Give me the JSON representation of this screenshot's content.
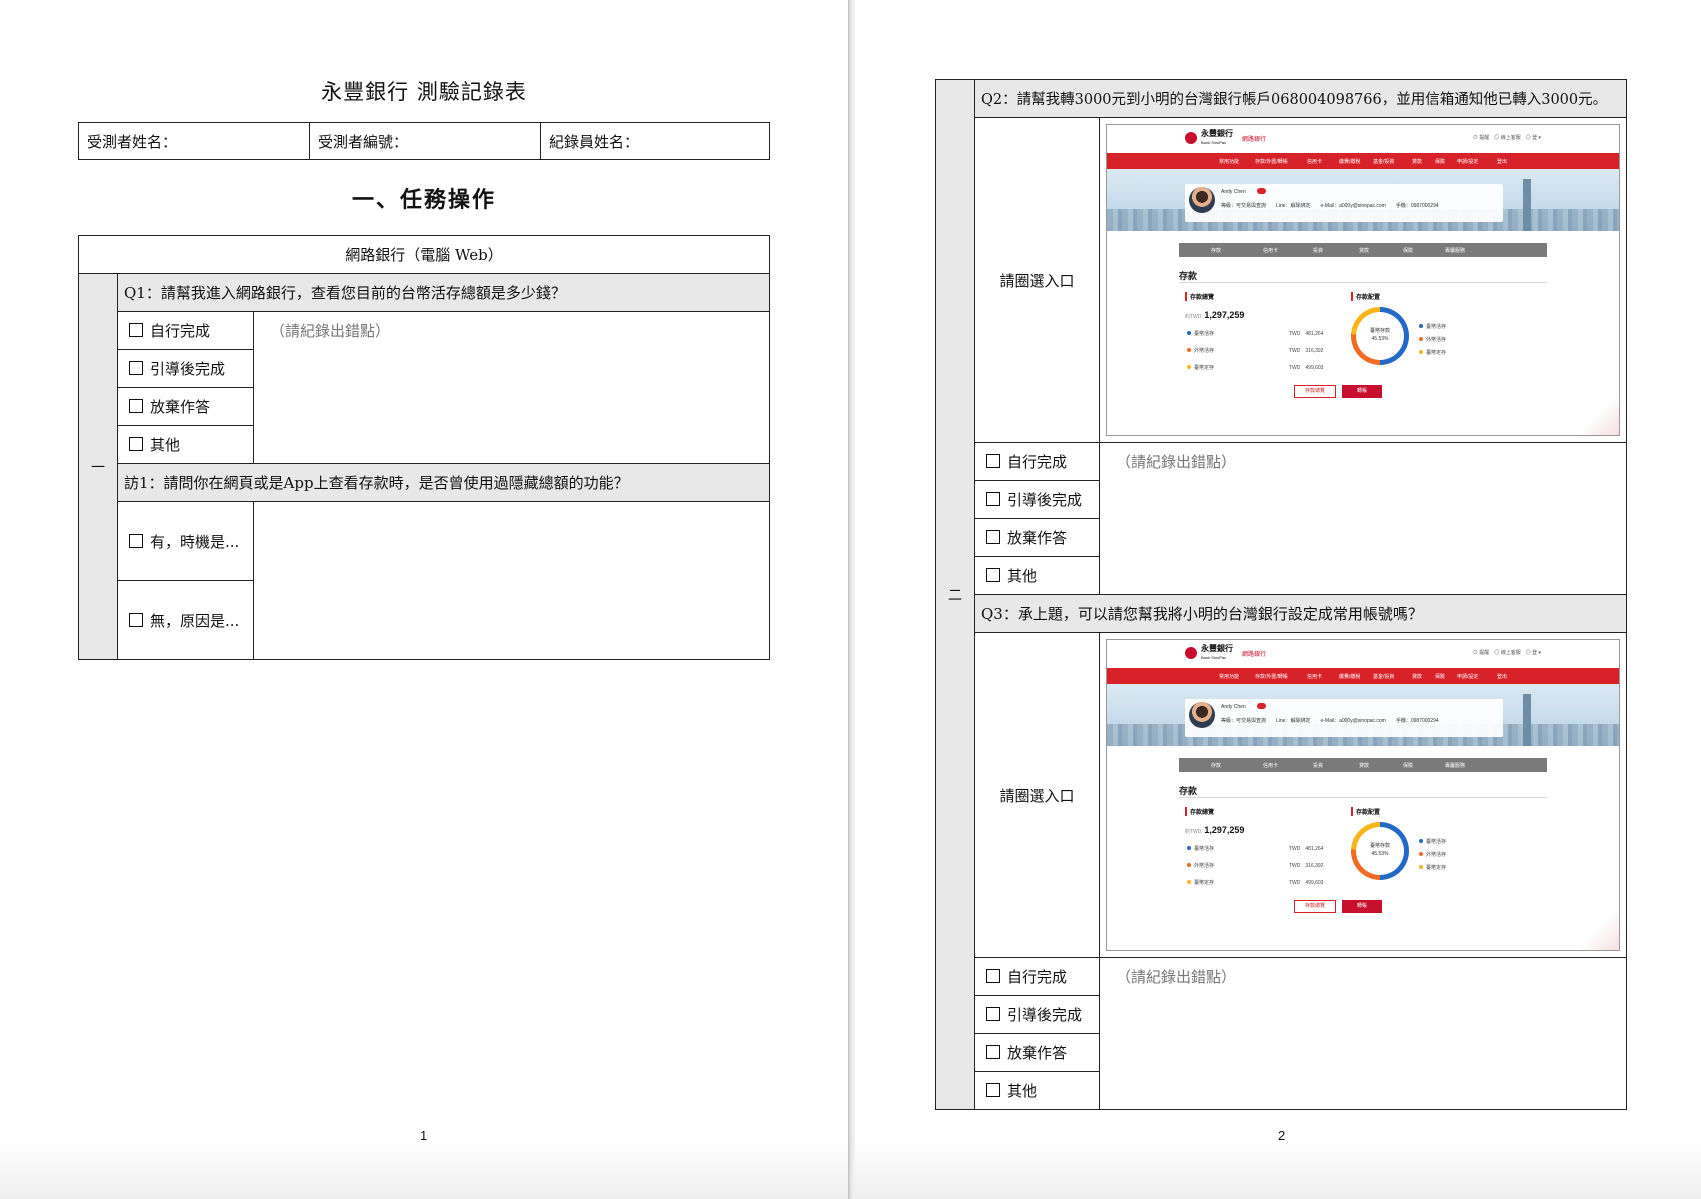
{
  "page1": {
    "title": "永豐銀行 測驗記錄表",
    "info": {
      "participant_name": "受測者姓名：",
      "participant_id": "受測者編號：",
      "recorder_name": "紀錄員姓名："
    },
    "section_title": "一、任務操作",
    "table_header": "網路銀行（電腦 Web）",
    "group_label": "一",
    "q1": "Q1：請幫我進入網路銀行，查看您目前的台幣活存總額是多少錢？",
    "options": [
      "自行完成",
      "引導後完成",
      "放棄作答",
      "其他"
    ],
    "note": "（請紀錄出錯點）",
    "interview": "訪1：請問你在網頁或是App上查看存款時，是否曾使用過隱藏總額的功能？",
    "interview_options": [
      "有，時機是...",
      "無，原因是..."
    ],
    "page_number": "1"
  },
  "page2": {
    "group_label": "二",
    "q2": "Q2：請幫我轉3000元到小明的台灣銀行帳戶068004098766，並用信箱通知他已轉入3000元。",
    "q3": "Q3：承上題，可以請您幫我將小明的台灣銀行設定成常用帳號嗎？",
    "circle_label": "請圈選入口",
    "options": [
      "自行完成",
      "引導後完成",
      "放棄作答",
      "其他"
    ],
    "note": "（請紀錄出錯點）",
    "page_number": "2"
  },
  "screenshot": {
    "logo": "永豐銀行",
    "logo_en": "Bank SinoPac",
    "logo_sub": "網路銀行",
    "top_links": "⊙ 提醒　◎ 線上客服　◎ 登 ▾",
    "nav": [
      "常用功能",
      "存款/外匯/轉帳",
      "信用卡",
      "繳費/繳稅",
      "基金/投資",
      "貸款",
      "保險",
      "申請/設定",
      "登出"
    ],
    "profile_name": "Andy Chen",
    "profile_info": "等級：可交易與查詢　　Line：解除綁定　　e-Mail：a000y@sinopac.com　　手機：0987000294",
    "tabs": [
      "存款",
      "信用卡",
      "投資",
      "貸款",
      "保險",
      "專屬服務"
    ],
    "deposit_title": "存款",
    "overview_label": "存款總覽",
    "allocation_label": "存款配置",
    "total_prefix": "約TWD",
    "total": "1,297,259",
    "accounts": [
      {
        "name": "臺幣活存",
        "value": "TWD　481,264",
        "color": "#2468c8"
      },
      {
        "name": "外幣活存",
        "value": "TWD　316,392",
        "color": "#f26b23"
      },
      {
        "name": "臺幣定存",
        "value": "TWD　499,603",
        "color": "#f8b619"
      }
    ],
    "donut_label": "臺幣存款",
    "donut_pct": "45.53%",
    "legend": [
      {
        "name": "臺幣活存",
        "color": "#2468c8"
      },
      {
        "name": "外幣活存",
        "color": "#f26b23"
      },
      {
        "name": "臺幣定存",
        "color": "#f8b619"
      }
    ],
    "btn_overview": "存款總覽",
    "btn_transfer": "轉帳"
  }
}
